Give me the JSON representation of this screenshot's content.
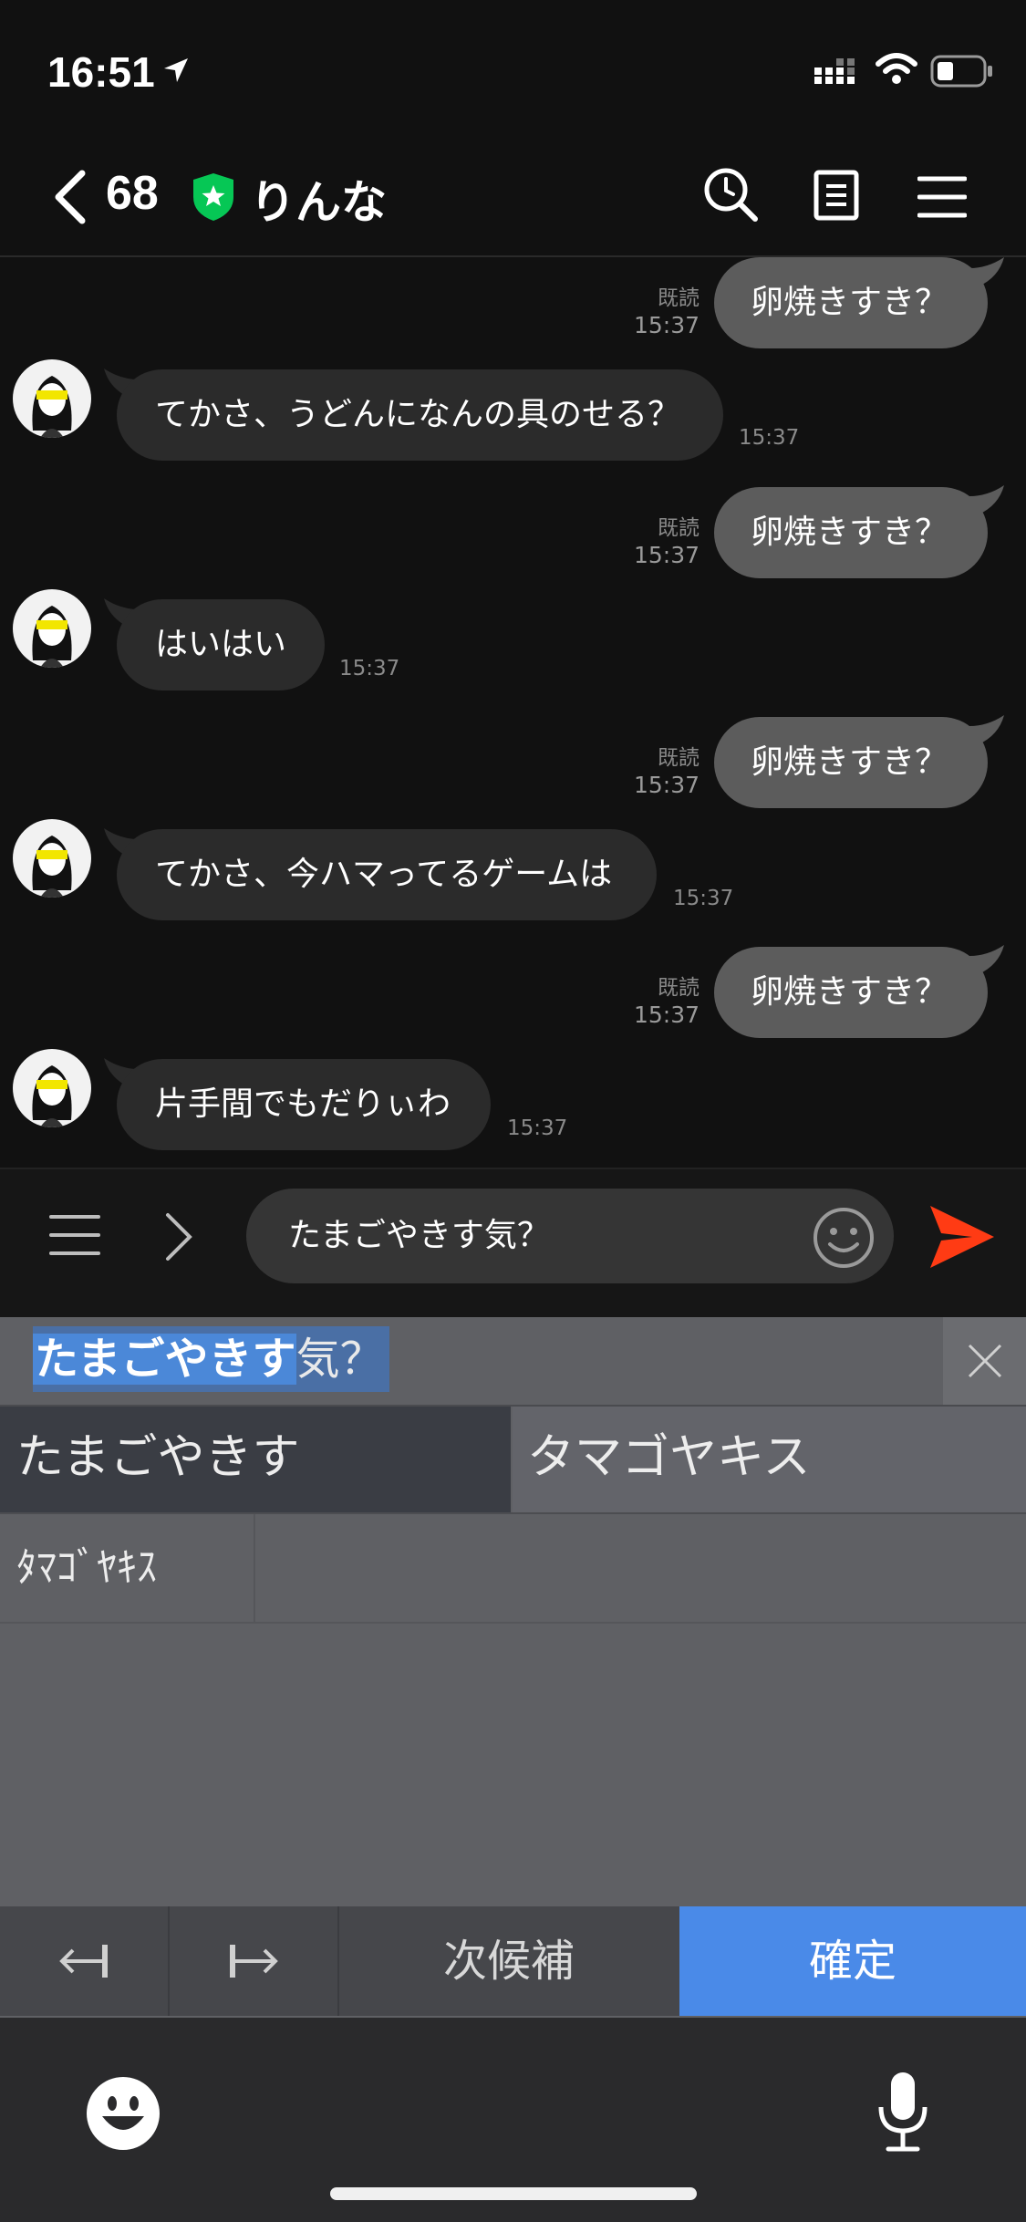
{
  "status_bar": {
    "time": "16:51"
  },
  "header": {
    "unread_count": "68",
    "contact_name": "りんな"
  },
  "messages": [
    {
      "side": "out",
      "text": "卵焼きすき？",
      "read": "既読",
      "time": "15:37"
    },
    {
      "side": "in",
      "text": "てかさ、うどんになんの具のせる？",
      "time": "15:37"
    },
    {
      "side": "out",
      "text": "卵焼きすき？",
      "read": "既読",
      "time": "15:37"
    },
    {
      "side": "in",
      "text": "はいはい",
      "time": "15:37"
    },
    {
      "side": "out",
      "text": "卵焼きすき？",
      "read": "既読",
      "time": "15:37"
    },
    {
      "side": "in",
      "text": "てかさ、今ハマってるゲームは",
      "time": "15:37"
    },
    {
      "side": "out",
      "text": "卵焼きすき？",
      "read": "既読",
      "time": "15:37"
    },
    {
      "side": "in",
      "text": "片手間でもだりぃわ",
      "time": "15:37"
    }
  ],
  "input": {
    "value": "たまごやきす気？"
  },
  "ime": {
    "compose_selected": "たまごやきす",
    "compose_rest": "気？",
    "candidates": [
      "たまごやきす",
      "タマゴヤキス",
      "ﾀﾏｺﾞﾔｷｽ"
    ],
    "next_candidate": "次候補",
    "confirm": "確定"
  },
  "colors": {
    "send": "#ff3b14",
    "confirm": "#4a8ae8",
    "shield": "#06c755"
  }
}
